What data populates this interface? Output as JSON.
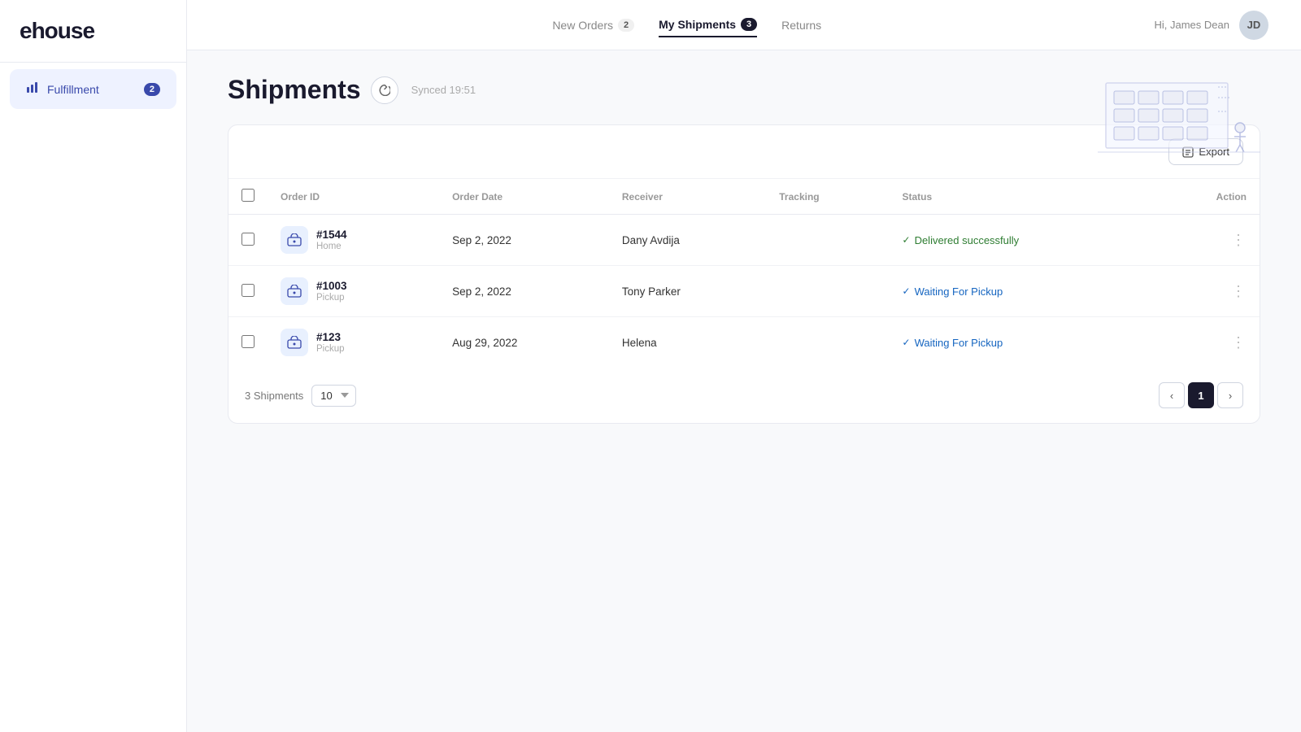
{
  "logo": {
    "text": "ehouse"
  },
  "sidebar": {
    "items": [
      {
        "id": "fulfillment",
        "label": "Fulfillment",
        "badge": "2",
        "icon": "📊"
      }
    ]
  },
  "topnav": {
    "items": [
      {
        "id": "new-orders",
        "label": "New Orders",
        "badge": "2",
        "active": false
      },
      {
        "id": "my-shipments",
        "label": "My Shipments",
        "badge": "3",
        "active": true
      },
      {
        "id": "returns",
        "label": "Returns",
        "badge": "",
        "active": false
      }
    ],
    "greeting": "Hi, James Dean",
    "avatar_initials": "JD"
  },
  "page": {
    "title": "Shipments",
    "sync_label": "Synced 19:51"
  },
  "toolbar": {
    "export_label": "Export"
  },
  "table": {
    "columns": [
      {
        "id": "order-id",
        "label": "Order ID"
      },
      {
        "id": "order-date",
        "label": "Order Date"
      },
      {
        "id": "receiver",
        "label": "Receiver"
      },
      {
        "id": "tracking",
        "label": "Tracking"
      },
      {
        "id": "status",
        "label": "Status"
      },
      {
        "id": "action",
        "label": "Action"
      }
    ],
    "rows": [
      {
        "id": "#1544",
        "sub": "Home",
        "date": "Sep 2, 2022",
        "receiver": "Dany Avdija",
        "tracking": "",
        "status": "Delivered successfully",
        "status_type": "delivered"
      },
      {
        "id": "#1003",
        "sub": "Pickup",
        "date": "Sep 2, 2022",
        "receiver": "Tony Parker",
        "tracking": "",
        "status": "Waiting For Pickup",
        "status_type": "waiting"
      },
      {
        "id": "#123",
        "sub": "Pickup",
        "date": "Aug 29, 2022",
        "receiver": "Helena",
        "tracking": "",
        "status": "Waiting For Pickup",
        "status_type": "waiting"
      }
    ]
  },
  "pagination": {
    "total_label": "3 Shipments",
    "page_size": "10",
    "current_page": "1"
  }
}
